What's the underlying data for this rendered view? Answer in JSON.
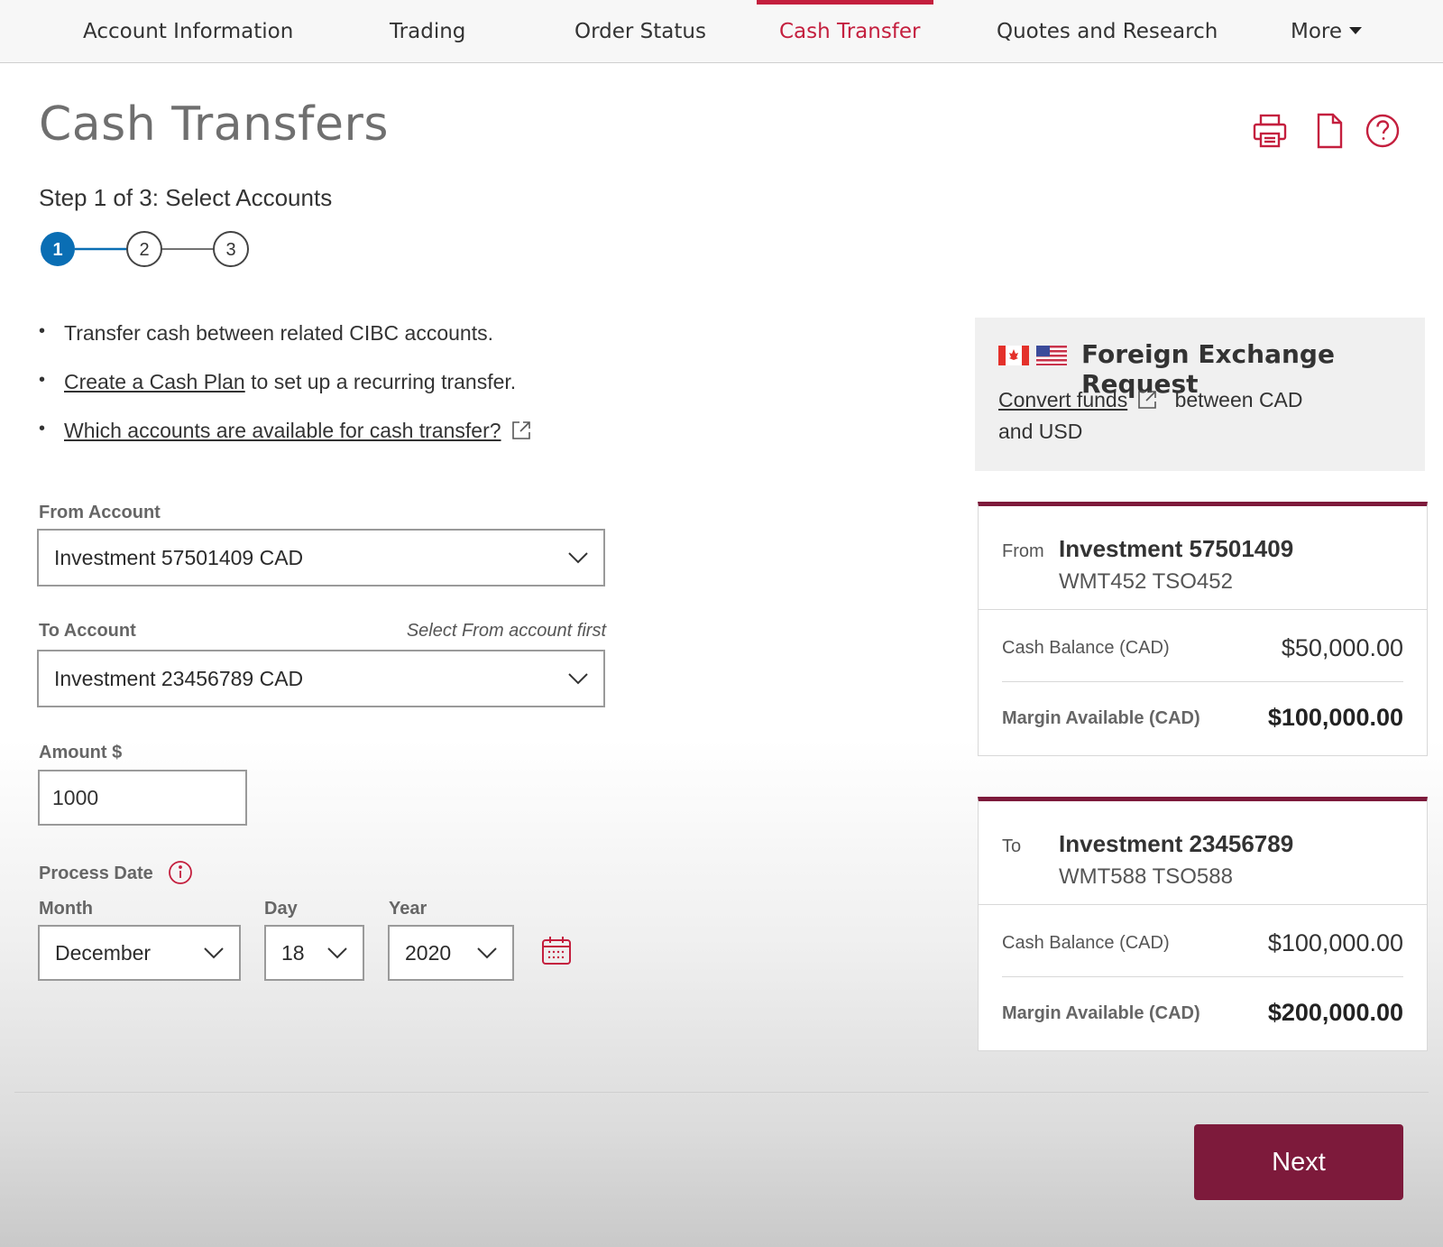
{
  "nav": {
    "items": [
      "Account Information",
      "Trading",
      "Order Status",
      "Cash Transfer",
      "Quotes and Research",
      "More"
    ],
    "active": "Cash Transfer"
  },
  "page": {
    "title": "Cash Transfers",
    "step_title": "Step 1 of 3: Select Accounts",
    "steps": [
      "1",
      "2",
      "3"
    ],
    "current_step": 1
  },
  "bullets": {
    "b1": "Transfer cash between related CIBC accounts.",
    "b2_link": "Create a Cash Plan",
    "b2_rest": " to set up a recurring transfer.",
    "b3_link": "Which accounts are available for cash transfer?"
  },
  "form": {
    "from_label": "From Account",
    "from_value": "Investment 57501409 CAD",
    "to_label": "To Account",
    "to_hint": "Select From account first",
    "to_value": "Investment 23456789 CAD",
    "amount_label": "Amount $",
    "amount_value": "1000",
    "process_date_label": "Process Date",
    "month_label": "Month",
    "month_value": "December",
    "day_label": "Day",
    "day_value": "18",
    "year_label": "Year",
    "year_value": "2020"
  },
  "fx": {
    "title": "Foreign Exchange Request",
    "link": "Convert funds",
    "text_after": "between CAD",
    "text_line2": "and USD"
  },
  "from_card": {
    "dir": "From",
    "name": "Investment 57501409",
    "sub": "WMT452 TSO452",
    "cash_label": "Cash Balance (CAD)",
    "cash_value": "$50,000.00",
    "margin_label": "Margin Available (CAD)",
    "margin_value": "$100,000.00"
  },
  "to_card": {
    "dir": "To",
    "name": "Investment 23456789",
    "sub": "WMT588 TSO588",
    "cash_label": "Cash Balance (CAD)",
    "cash_value": "$100,000.00",
    "margin_label": "Margin Available (CAD)",
    "margin_value": "$200,000.00"
  },
  "actions": {
    "next_label": "Next"
  },
  "colors": {
    "accent_red": "#c41f3e",
    "brand_burgundy": "#7d1a3b",
    "step_active": "#0a6eb4"
  }
}
